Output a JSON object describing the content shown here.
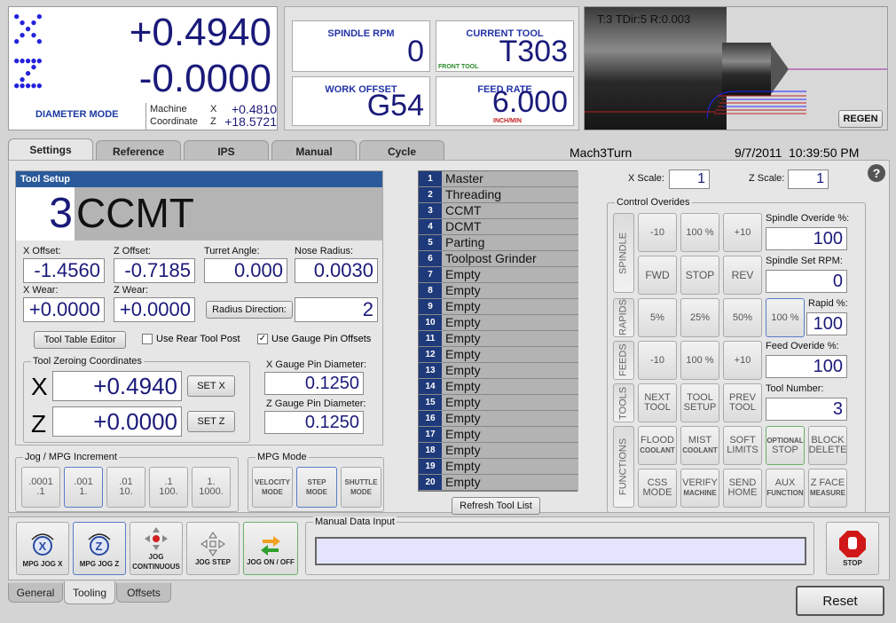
{
  "dro": {
    "x_value": "+0.4940",
    "z_value": "-0.0000",
    "mode": "DIAMETER MODE",
    "machine_label": "Machine",
    "coordinate_label": "Coordinate",
    "x_axis": "X",
    "z_axis": "Z",
    "machine_x": "+0.4810",
    "coordinate_z": "+18.5721"
  },
  "status": {
    "spindle_rpm_label": "SPINDLE RPM",
    "spindle_rpm": "0",
    "current_tool_label": "CURRENT TOOL",
    "current_tool": "T303",
    "front_tool": "FRONT TOOL",
    "work_offset_label": "WORK OFFSET",
    "work_offset": "G54",
    "feed_rate_label": "FEED RATE",
    "feed_rate": "6.000",
    "feed_units": "INCH/MIN"
  },
  "preview": {
    "info": "T:3 TDir:5 R:0.003",
    "regen": "REGEN"
  },
  "tabs": [
    "Settings",
    "Reference",
    "IPS",
    "Manual",
    "Cycle"
  ],
  "header": {
    "app": "Mach3Turn",
    "date": "9/7/2011",
    "time": "10:39:50 PM",
    "help": "?"
  },
  "tool_setup": {
    "title": "Tool Setup",
    "number": "3",
    "name": "CCMT",
    "x_offset_label": "X Offset:",
    "x_offset": "-1.4560",
    "z_offset_label": "Z Offset:",
    "z_offset": "-0.7185",
    "turret_label": "Turret Angle:",
    "turret": "0.000",
    "nose_label": "Nose Radius:",
    "nose": "0.0030",
    "x_wear_label": "X Wear:",
    "x_wear": "+0.0000",
    "z_wear_label": "Z Wear:",
    "z_wear": "+0.0000",
    "radius_dir_button": "Radius Direction:",
    "radius_dir": "2",
    "tool_table_button": "Tool Table Editor",
    "rear_post": "Use Rear Tool Post",
    "gauge_pin": "Use Gauge Pin Offsets"
  },
  "zeroing": {
    "title": "Tool Zeroing Coordinates",
    "x_label": "X",
    "x_value": "+0.4940",
    "set_x": "SET X",
    "z_label": "Z",
    "z_value": "+0.0000",
    "set_z": "SET Z",
    "xg_label": "X Gauge Pin Diameter:",
    "xg": "0.1250",
    "zg_label": "Z Gauge Pin Diameter:",
    "zg": "0.1250"
  },
  "jog": {
    "title": "Jog / MPG Increment",
    "incs": [
      [
        ".0001",
        ".1"
      ],
      [
        ".001",
        "1."
      ],
      [
        ".01",
        "10."
      ],
      [
        ".1",
        "100."
      ],
      [
        "1.",
        "1000."
      ]
    ]
  },
  "mpg": {
    "title": "MPG Mode",
    "modes": [
      [
        "VELOCITY",
        "MODE"
      ],
      [
        "STEP",
        "MODE"
      ],
      [
        "SHUTTLE",
        "MODE"
      ]
    ]
  },
  "tools": [
    {
      "n": "1",
      "name": "Master"
    },
    {
      "n": "2",
      "name": "Threading"
    },
    {
      "n": "3",
      "name": "CCMT"
    },
    {
      "n": "4",
      "name": "DCMT"
    },
    {
      "n": "5",
      "name": "Parting"
    },
    {
      "n": "6",
      "name": "Toolpost Grinder"
    },
    {
      "n": "7",
      "name": "Empty"
    },
    {
      "n": "8",
      "name": "Empty"
    },
    {
      "n": "9",
      "name": "Empty"
    },
    {
      "n": "10",
      "name": "Empty"
    },
    {
      "n": "11",
      "name": "Empty"
    },
    {
      "n": "12",
      "name": "Empty"
    },
    {
      "n": "13",
      "name": "Empty"
    },
    {
      "n": "14",
      "name": "Empty"
    },
    {
      "n": "15",
      "name": "Empty"
    },
    {
      "n": "16",
      "name": "Empty"
    },
    {
      "n": "17",
      "name": "Empty"
    },
    {
      "n": "18",
      "name": "Empty"
    },
    {
      "n": "19",
      "name": "Empty"
    },
    {
      "n": "20",
      "name": "Empty"
    }
  ],
  "refresh": "Refresh Tool List",
  "scale": {
    "x_label": "X Scale:",
    "x": "1",
    "z_label": "Z Scale:",
    "z": "1"
  },
  "overrides": {
    "title": "Control Overides",
    "spindle": "SPINDLE",
    "rapids": "RAPIDS",
    "feeds": "FEEDS",
    "tools": "TOOLS",
    "functions": "FUNCTIONS",
    "sp_minus": "-10",
    "sp_100": "100 %",
    "sp_plus": "+10",
    "fwd": "FWD",
    "stop": "STOP",
    "rev": "REV",
    "r5": "5%",
    "r25": "25%",
    "r50": "50%",
    "r100": "100 %",
    "f_minus": "-10",
    "f_100": "100 %",
    "f_plus": "+10",
    "next_tool": [
      "NEXT",
      "TOOL"
    ],
    "tool_setup": [
      "TOOL",
      "SETUP"
    ],
    "prev_tool": [
      "PREV",
      "TOOL"
    ],
    "flood": [
      "FLOOD",
      "COOLANT"
    ],
    "mist": [
      "MIST",
      "COOLANT"
    ],
    "soft": [
      "SOFT",
      "LIMITS"
    ],
    "opt_stop": [
      "OPTIONAL",
      "STOP"
    ],
    "block_delete": [
      "BLOCK",
      "DELETE"
    ],
    "css": [
      "CSS",
      "MODE"
    ],
    "verify": [
      "VERIFY",
      "MACHINE"
    ],
    "send_home": [
      "SEND",
      "HOME"
    ],
    "aux": [
      "AUX",
      "FUNCTION"
    ],
    "zface": [
      "Z FACE",
      "MEASURE"
    ],
    "spindle_ov_label": "Spindle Overide %:",
    "spindle_ov": "100",
    "spindle_set_label": "Spindle Set RPM:",
    "spindle_set": "0",
    "rapid_label": "Rapid %:",
    "rapid": "100",
    "feed_ov_label": "Feed Overide %:",
    "feed_ov": "100",
    "tool_num_label": "Tool Number:",
    "tool_num": "3"
  },
  "bottom": {
    "mpg_jog_x": "MPG JOG X",
    "mpg_jog_z": "MPG JOG Z",
    "jog_cont": [
      "JOG",
      "CONTINUOUS"
    ],
    "jog_step": "JOG STEP",
    "jog_onoff": "JOG ON / OFF",
    "mdi_label": "Manual Data Input",
    "stop": "STOP",
    "reset": "Reset"
  },
  "subtabs": [
    "General",
    "Tooling",
    "Offsets"
  ],
  "colors": {
    "accent": "#2a5a9a",
    "list_num": "#1e3a7a",
    "dro_text": "#1a1a7a",
    "status_title": "#2433a8"
  }
}
